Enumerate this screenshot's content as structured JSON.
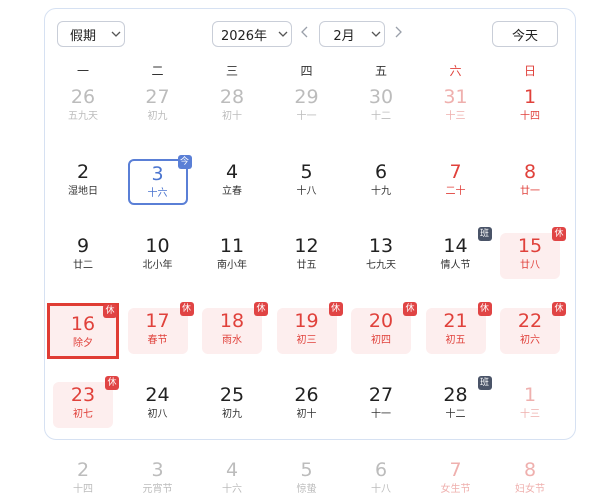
{
  "toolbar": {
    "holiday_select": "假期",
    "year_select": "2026年",
    "month_select": "2月",
    "prev_icon": "chevron-left-icon",
    "next_icon": "chevron-right-icon",
    "today_button": "今天"
  },
  "weekdays": [
    {
      "label": "一",
      "weekend": false
    },
    {
      "label": "二",
      "weekend": false
    },
    {
      "label": "三",
      "weekend": false
    },
    {
      "label": "四",
      "weekend": false
    },
    {
      "label": "五",
      "weekend": false
    },
    {
      "label": "六",
      "weekend": true
    },
    {
      "label": "日",
      "weekend": true
    }
  ],
  "days": [
    {
      "num": "26",
      "sub": "五九天",
      "style": "dim"
    },
    {
      "num": "27",
      "sub": "初九",
      "style": "dim"
    },
    {
      "num": "28",
      "sub": "初十",
      "style": "dim"
    },
    {
      "num": "29",
      "sub": "十一",
      "style": "dim"
    },
    {
      "num": "30",
      "sub": "十二",
      "style": "dim"
    },
    {
      "num": "31",
      "sub": "十三",
      "style": "dimred"
    },
    {
      "num": "1",
      "sub": "十四",
      "style": "red"
    },
    {
      "num": "2",
      "sub": "湿地日",
      "style": "normal"
    },
    {
      "num": "3",
      "sub": "十六",
      "style": "blue",
      "today": true,
      "badge": "今"
    },
    {
      "num": "4",
      "sub": "立春",
      "style": "normal"
    },
    {
      "num": "5",
      "sub": "十八",
      "style": "normal"
    },
    {
      "num": "6",
      "sub": "十九",
      "style": "normal"
    },
    {
      "num": "7",
      "sub": "二十",
      "style": "red"
    },
    {
      "num": "8",
      "sub": "廿一",
      "style": "red"
    },
    {
      "num": "9",
      "sub": "廿二",
      "style": "normal"
    },
    {
      "num": "10",
      "sub": "北小年",
      "style": "normal"
    },
    {
      "num": "11",
      "sub": "南小年",
      "style": "normal"
    },
    {
      "num": "12",
      "sub": "廿五",
      "style": "normal"
    },
    {
      "num": "13",
      "sub": "七九天",
      "style": "normal"
    },
    {
      "num": "14",
      "sub": "情人节",
      "style": "normal",
      "badge": "班"
    },
    {
      "num": "15",
      "sub": "廿八",
      "style": "red",
      "holiday": true,
      "badge": "休"
    },
    {
      "num": "16",
      "sub": "除夕",
      "style": "red",
      "holiday": true,
      "selected": true,
      "badge": "休"
    },
    {
      "num": "17",
      "sub": "春节",
      "style": "red",
      "holiday": true,
      "badge": "休"
    },
    {
      "num": "18",
      "sub": "雨水",
      "style": "red",
      "holiday": true,
      "badge": "休"
    },
    {
      "num": "19",
      "sub": "初三",
      "style": "red",
      "holiday": true,
      "badge": "休"
    },
    {
      "num": "20",
      "sub": "初四",
      "style": "red",
      "holiday": true,
      "badge": "休"
    },
    {
      "num": "21",
      "sub": "初五",
      "style": "red",
      "holiday": true,
      "badge": "休"
    },
    {
      "num": "22",
      "sub": "初六",
      "style": "red",
      "holiday": true,
      "badge": "休"
    },
    {
      "num": "23",
      "sub": "初七",
      "style": "red",
      "holiday": true,
      "badge": "休"
    },
    {
      "num": "24",
      "sub": "初八",
      "style": "normal"
    },
    {
      "num": "25",
      "sub": "初九",
      "style": "normal"
    },
    {
      "num": "26",
      "sub": "初十",
      "style": "normal"
    },
    {
      "num": "27",
      "sub": "十一",
      "style": "normal"
    },
    {
      "num": "28",
      "sub": "十二",
      "style": "normal",
      "badge": "班"
    },
    {
      "num": "1",
      "sub": "十三",
      "style": "dimred"
    },
    {
      "num": "2",
      "sub": "十四",
      "style": "dim"
    },
    {
      "num": "3",
      "sub": "元宵节",
      "style": "dim"
    },
    {
      "num": "4",
      "sub": "十六",
      "style": "dim"
    },
    {
      "num": "5",
      "sub": "惊蛰",
      "style": "dim"
    },
    {
      "num": "6",
      "sub": "十八",
      "style": "dim"
    },
    {
      "num": "7",
      "sub": "女生节",
      "style": "dimred"
    },
    {
      "num": "8",
      "sub": "妇女节",
      "style": "dimred"
    }
  ]
}
